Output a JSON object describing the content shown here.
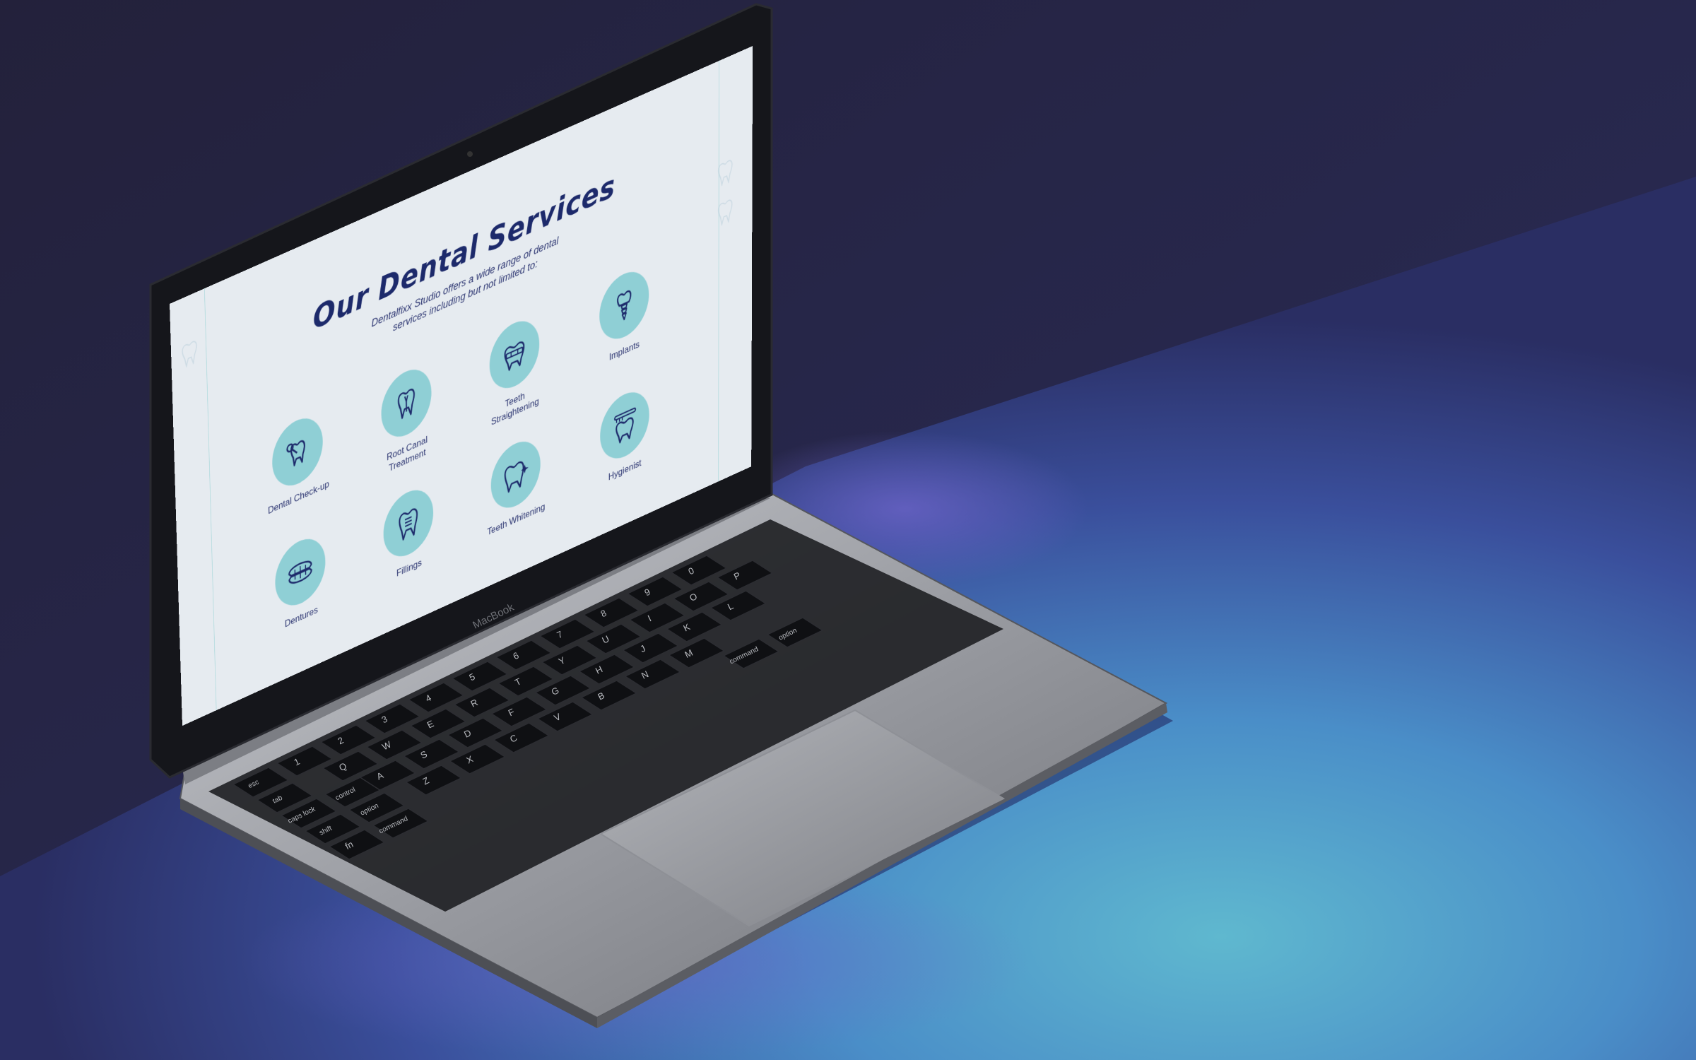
{
  "colors": {
    "page_background": "#e6ebf0",
    "accent_circle": "#8fcfd5",
    "text_navy": "#1d2a6b",
    "guide_line": "#a9d8db"
  },
  "screen": {
    "title": "Our Dental Services",
    "subtitle_line1": "Dentalfixx Studio offers a wide range of dental",
    "subtitle_line2": "services including but not limited to:",
    "services": [
      {
        "label": "Dental Check-up",
        "icon": "tooth-mirror-icon"
      },
      {
        "label": "Root Canal\nTreatment",
        "icon": "root-canal-tooth-icon"
      },
      {
        "label": "Teeth\nStraightening",
        "icon": "braces-tooth-icon"
      },
      {
        "label": "Implants",
        "icon": "implant-icon"
      },
      {
        "label": "Dentures",
        "icon": "dentures-icon"
      },
      {
        "label": "Fillings",
        "icon": "filling-tooth-icon"
      },
      {
        "label": "Teeth Whitening",
        "icon": "sparkle-tooth-icon"
      },
      {
        "label": "Hygienist",
        "icon": "toothbrush-tooth-icon"
      }
    ]
  },
  "laptop": {
    "brand_label": "MacBook"
  },
  "keyboard": {
    "keys": [
      {
        "label": "esc"
      },
      {
        "label": "tab"
      },
      {
        "label": "caps lock"
      },
      {
        "label": "shift"
      },
      {
        "label": "fn"
      },
      {
        "label": "control"
      },
      {
        "label": "option"
      },
      {
        "label": "command"
      },
      {
        "label": "command"
      },
      {
        "label": "option"
      },
      {
        "label": "1"
      },
      {
        "label": "2"
      },
      {
        "label": "3"
      },
      {
        "label": "4"
      },
      {
        "label": "5"
      },
      {
        "label": "6"
      },
      {
        "label": "7"
      },
      {
        "label": "8"
      },
      {
        "label": "9"
      },
      {
        "label": "0"
      },
      {
        "label": "Q"
      },
      {
        "label": "W"
      },
      {
        "label": "E"
      },
      {
        "label": "R"
      },
      {
        "label": "T"
      },
      {
        "label": "Y"
      },
      {
        "label": "U"
      },
      {
        "label": "I"
      },
      {
        "label": "O"
      },
      {
        "label": "P"
      },
      {
        "label": "A"
      },
      {
        "label": "S"
      },
      {
        "label": "D"
      },
      {
        "label": "F"
      },
      {
        "label": "G"
      },
      {
        "label": "H"
      },
      {
        "label": "J"
      },
      {
        "label": "K"
      },
      {
        "label": "L"
      },
      {
        "label": "Z"
      },
      {
        "label": "X"
      },
      {
        "label": "C"
      },
      {
        "label": "V"
      },
      {
        "label": "B"
      },
      {
        "label": "N"
      },
      {
        "label": "M"
      }
    ]
  }
}
